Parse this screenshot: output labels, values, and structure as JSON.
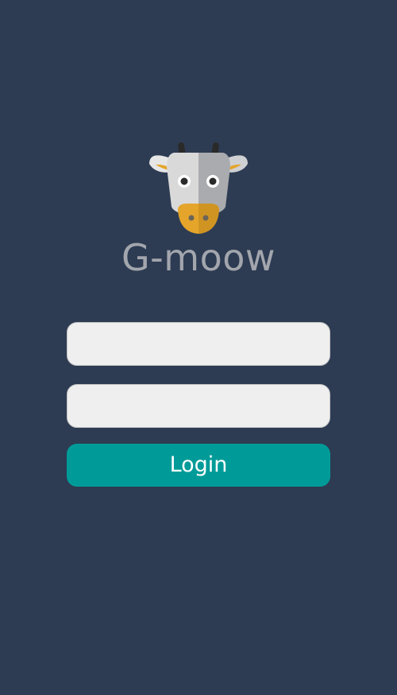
{
  "app": {
    "title": "G-moow",
    "logo_icon": "cow-head-icon"
  },
  "form": {
    "username": {
      "value": "",
      "placeholder": ""
    },
    "password": {
      "value": "",
      "placeholder": ""
    },
    "login_label": "Login"
  },
  "colors": {
    "background": "#2d3c53",
    "title": "#a3a6ad",
    "field_background": "#efefef",
    "button": "#009b98",
    "button_text": "#ffffff",
    "logo_accent": "#e4a52a"
  }
}
